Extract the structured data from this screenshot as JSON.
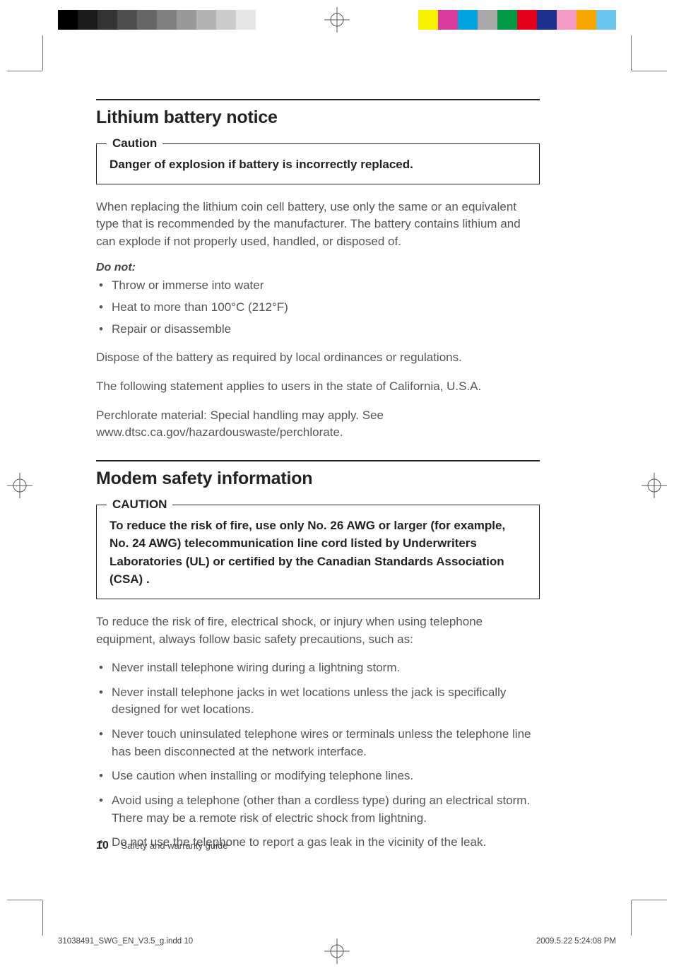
{
  "colorbars": {
    "left": [
      "#000000",
      "#1a1a1a",
      "#333333",
      "#4d4d4d",
      "#666666",
      "#808080",
      "#999999",
      "#b3b3b3",
      "#cccccc",
      "#e6e6e6",
      "#ffffff"
    ],
    "right": [
      "#f7f300",
      "#d83b9b",
      "#00a2e0",
      "#a8a8a8",
      "#009946",
      "#e0001b",
      "#1d2f8b",
      "#f29ac1",
      "#f7a600",
      "#6cc6ee"
    ]
  },
  "section1": {
    "title": "Lithium battery notice",
    "caution_label": "Caution",
    "caution_text": "Danger of explosion if battery is incorrectly replaced.",
    "para1": "When replacing the lithium coin cell battery, use only the same or an equivalent type that is recommended by the manufacturer. The battery contains lithium and can explode if not properly used, handled, or disposed of.",
    "do_not_label": "Do not:",
    "do_not_items": [
      "Throw or immerse into water",
      "Heat to more than 100°C (212°F)",
      "Repair or disassemble"
    ],
    "para2": "Dispose of the battery as required by local ordinances or regulations.",
    "para3": "The following statement applies to users in the state of California, U.S.A.",
    "para4": "Perchlorate material: Special handling may apply. See www.dtsc.ca.gov/hazardouswaste/perchlorate."
  },
  "section2": {
    "title": "Modem safety information",
    "caution_label": "CAUTION",
    "caution_text": "To reduce the risk of fire, use only No. 26 AWG or larger (for example, No. 24 AWG) telecommunication line cord listed by Underwriters Laboratories (UL) or certified by the Canadian Standards Association (CSA) .",
    "para1": "To reduce the risk of fire, electrical shock, or injury when using telephone equipment, always follow basic safety precautions, such as:",
    "items": [
      "Never install telephone wiring during a lightning storm.",
      "Never install telephone jacks in wet locations unless the jack is specifically designed for wet locations.",
      "Never touch uninsulated telephone wires or terminals unless the telephone line has been disconnected at the network interface.",
      "Use caution when installing or modifying telephone lines.",
      "Avoid using a telephone (other than a cordless type) during an electrical storm. There may be a remote risk of electric shock from lightning.",
      "Do not use the telephone to report a gas leak in the vicinity of the leak."
    ]
  },
  "footer": {
    "page_number": "10",
    "book_title": "Safety and warranty guide"
  },
  "slug": {
    "file": "31038491_SWG_EN_V3.5_g.indd   10",
    "date": "2009.5.22   5:24:08 PM"
  }
}
